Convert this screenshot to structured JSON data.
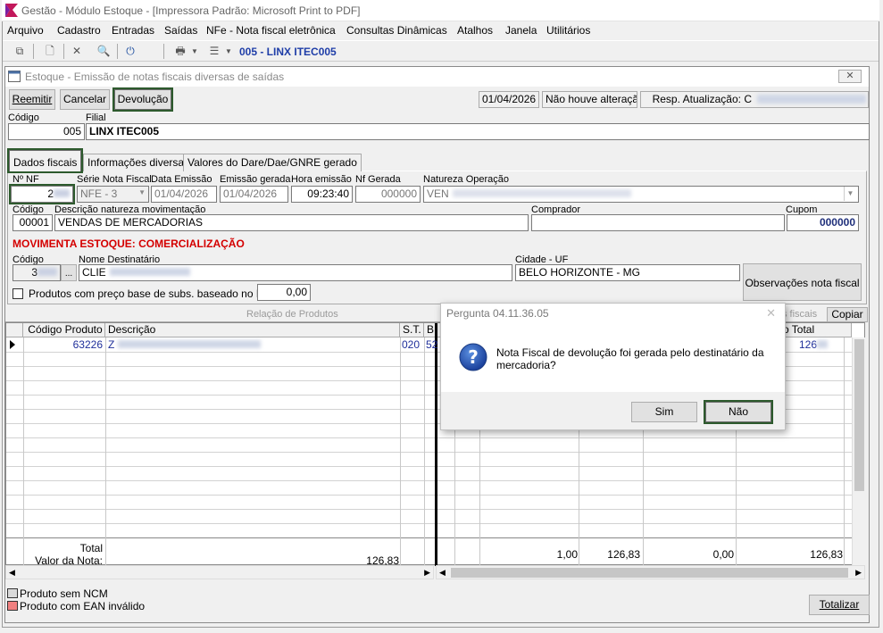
{
  "app": {
    "title": "Gestão  - Módulo Estoque - [Impressora Padrão: Microsoft Print to PDF]"
  },
  "menu": [
    "Arquivo",
    "Cadastro",
    "Entradas",
    "Saídas",
    "NFe - Nota fiscal eletrônica",
    "Consultas Dinâmicas",
    "Atalhos",
    "Janela",
    "Utilitários"
  ],
  "toolbar": {
    "company": "005 - LINX ITEC005"
  },
  "window": {
    "title": "Estoque - Emissão de notas fiscais diversas de saídas",
    "close": "✕"
  },
  "actions": {
    "reemitir": "Reemitir",
    "cancelar": "Cancelar",
    "devolucao": "Devolução"
  },
  "status": {
    "date": "01/04/2026",
    "change": "Não houve alteração",
    "resp": "Resp. Atualização: C"
  },
  "header": {
    "codigo_label": "Código",
    "filial_label": "Filial",
    "codigo": "005",
    "filial": "LINX ITEC005"
  },
  "tabs": [
    "Dados fiscais",
    "Informações diversas",
    "Valores do Dare/Dae/GNRE gerado",
    "Nf Gerada"
  ],
  "fiscal": {
    "nf_label": "Nº NF",
    "nf": "2",
    "serie_label": "Série Nota Fiscal",
    "serie": "NFE - 3",
    "data_label": "Data Emissão",
    "data": "01/04/2026",
    "emgerada_label": "Emissão gerada",
    "emgerada": "01/04/2026",
    "hora_label": "Hora emissão",
    "hora": "09:23:40",
    "nfgerada_label": "Nf Gerada",
    "nfgerada": "000000",
    "natureza_label": "Natureza  Operação",
    "natureza": "VEN",
    "cod_label": "Código",
    "cod": "00001",
    "desc_label": "Descrição natureza movimentação",
    "desc": "VENDAS DE MERCADORIAS",
    "comprador_label": "Comprador",
    "comprador": "",
    "cupom_label": "Cupom",
    "cupom": "000000"
  },
  "movimenta": "MOVIMENTA ESTOQUE: COMERCIALIZAÇÃO",
  "dest": {
    "cod_label": "Código",
    "cod": "3",
    "dots": "...",
    "nome_label": "Nome Destinatário",
    "nome": "CLIE",
    "cidade_label": "Cidade - UF",
    "cidade": "BELO HORIZONTE - MG",
    "obs_button": "Observações nota fiscal"
  },
  "pmc": {
    "label": "Produtos com preço base de subs. baseado no PMC",
    "value": "0,00"
  },
  "products": {
    "title": "Relação de Produtos",
    "extra_label": "s fiscais",
    "copiar": "Copiar",
    "cols": [
      "Código Produto",
      "Descrição",
      "S.T.",
      "B."
    ],
    "right_col": "o Total",
    "row": {
      "codigo": "63226",
      "desc": "Z",
      "st": "020",
      "b": "52",
      "total": "126"
    },
    "total_label": "Total",
    "valor_label": "Valor da Nota:",
    "valor": "126,83",
    "footer": [
      "1,00",
      "126,83",
      "0,00",
      "126,83"
    ]
  },
  "legend": {
    "ncm": "Produto sem NCM",
    "ean": "Produto com EAN inválido"
  },
  "totalizar": "Totalizar",
  "dialog": {
    "title": "Pergunta 04.11.36.05",
    "message": "Nota Fiscal de devolução foi gerada pelo destinatário da mercadoria?",
    "yes": "Sim",
    "no": "Não",
    "icon": "question-icon"
  }
}
